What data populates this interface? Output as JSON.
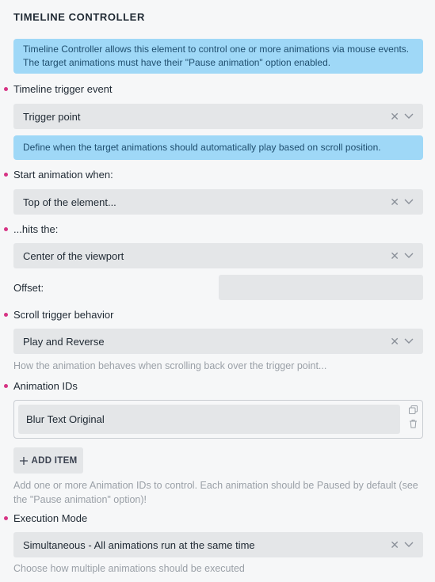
{
  "section": {
    "title": "TIMELINE CONTROLLER"
  },
  "info_main": "Timeline Controller allows this element to control one or more animations via mouse events. The target animations must have their \"Pause animation\" option enabled.",
  "trigger_event": {
    "label": "Timeline trigger event",
    "value": "Trigger point"
  },
  "info_scroll": "Define when the target animations should automatically play based on scroll position.",
  "start_when": {
    "label": "Start animation when:",
    "value": "Top of the element..."
  },
  "hits_the": {
    "label": "...hits the:",
    "value": "Center of the viewport"
  },
  "offset": {
    "label": "Offset:",
    "value": ""
  },
  "scroll_behavior": {
    "label": "Scroll trigger behavior",
    "value": "Play and Reverse",
    "help": "How the animation behaves when scrolling back over the trigger point..."
  },
  "animation_ids": {
    "label": "Animation IDs",
    "items": [
      "Blur Text Original"
    ],
    "add_label": "ADD ITEM",
    "help": "Add one or more Animation IDs to control. Each animation should be Paused by default (see the \"Pause animation\" option)!"
  },
  "execution_mode": {
    "label": "Execution Mode",
    "value": "Simultaneous - All animations run at the same time",
    "help": "Choose how multiple animations should be executed"
  },
  "colors": {
    "required_dot": "#d63384",
    "info_bg": "#9fd8f7",
    "field_bg": "#e4e6e8"
  }
}
